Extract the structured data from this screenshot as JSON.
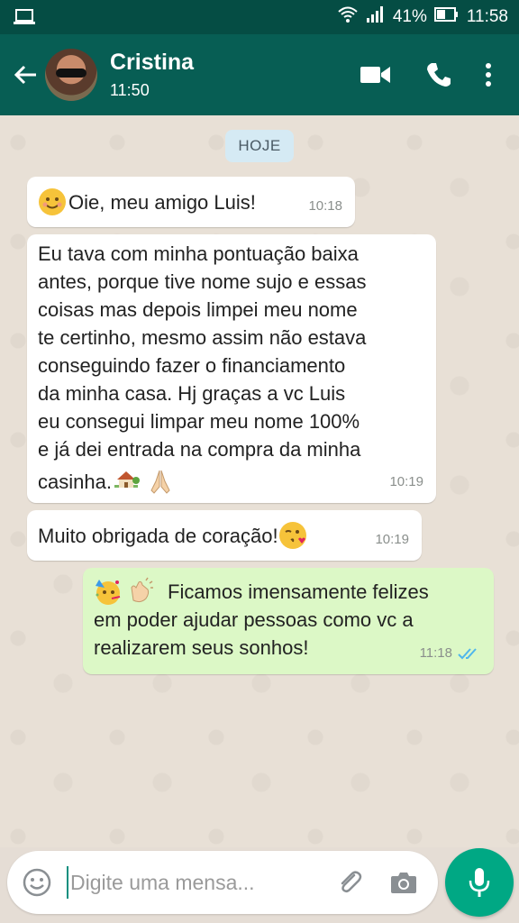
{
  "status_bar": {
    "battery_percent": "41%",
    "time": "11:58",
    "icons": [
      "laptop-icon",
      "wifi-icon",
      "signal-icon",
      "battery-icon"
    ]
  },
  "header": {
    "contact_name": "Cristina",
    "subtitle": "11:50",
    "icons": [
      "back-arrow-icon",
      "video-call-icon",
      "phone-icon",
      "more-options-icon"
    ]
  },
  "chat": {
    "date_chip": "HOJE",
    "messages": [
      {
        "direction": "in",
        "text": "Oie, meu amigo Luis!",
        "time": "10:18",
        "emoji": [
          "smiling-face"
        ]
      },
      {
        "direction": "in",
        "lines": [
          "Eu tava com minha pontuação baixa",
          "antes, porque tive nome sujo e essas",
          "coisas mas depois limpei meu nome",
          "te certinho, mesmo assim não estava",
          "conseguindo fazer o financiamento",
          "da minha casa. Hj graças a vc Luis",
          "eu consegui limpar meu nome 100%",
          "e já dei entrada na compra da minha",
          "casinha."
        ],
        "time": "10:19",
        "emoji": [
          "house",
          "praying-hands"
        ]
      },
      {
        "direction": "in",
        "text": "Muito obrigada de coração!",
        "time": "10:19",
        "emoji": [
          "face-blowing-kiss"
        ]
      },
      {
        "direction": "out",
        "lines": [
          "Ficamos imensamente felizes",
          "em poder ajudar pessoas como vc a",
          "realizarem seus sonhos!"
        ],
        "time": "11:18",
        "status": "read",
        "emoji": [
          "partying-face",
          "clapping-hands"
        ]
      }
    ]
  },
  "input": {
    "placeholder": "Digite uma mensa...",
    "icons": [
      "emoji-icon",
      "attachment-icon",
      "camera-icon",
      "microphone-icon"
    ]
  },
  "colors": {
    "header": "#075e54",
    "status_bar": "#054d44",
    "outgoing_bubble": "#dcf8c6",
    "incoming_bubble": "#ffffff",
    "date_chip": "#d5eaf4",
    "mic_button": "#00a884",
    "read_ticks": "#4fb6ec"
  }
}
